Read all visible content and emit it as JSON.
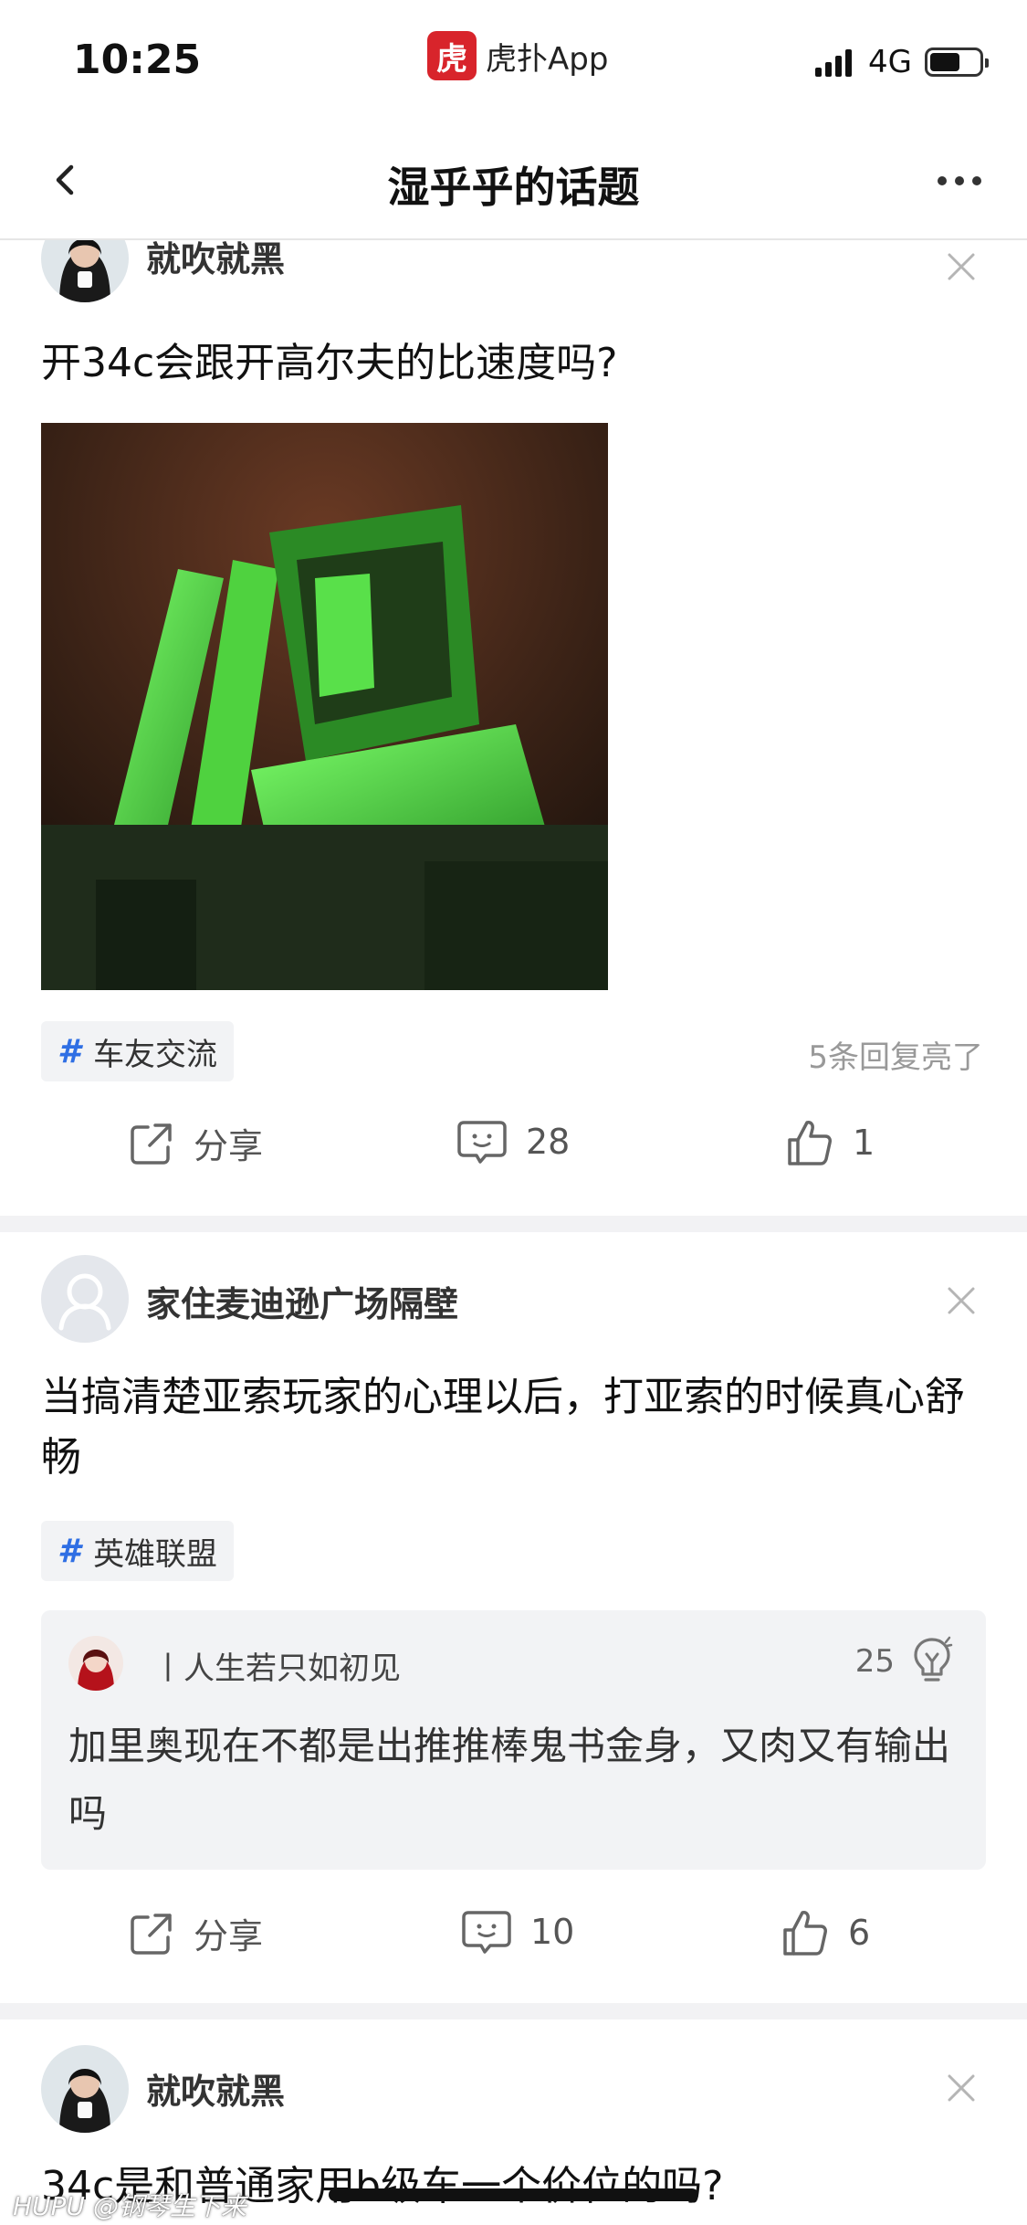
{
  "status_bar": {
    "time": "10:25",
    "app_logo_char": "虎",
    "app_name": "虎扑App",
    "network": "4G",
    "battery_level": 0.62
  },
  "nav": {
    "title": "湿乎乎的话题"
  },
  "posts": [
    {
      "author": "就吹就黑",
      "text": "开34c会跟开高尔夫的比速度吗?",
      "tag": "车友交流",
      "reply_note": "5条回复亮了",
      "share_label": "分享",
      "comments": "28",
      "likes": "1"
    },
    {
      "author": "家住麦迪逊广场隔壁",
      "text": "当搞清楚亚索玩家的心理以后，打亚索的时候真心舒畅",
      "tag": "英雄联盟",
      "hot_comment": {
        "author": "丨人生若只如初见",
        "likes": "25",
        "text": "加里奥现在不都是出推推棒鬼书金身，又肉又有输出吗"
      },
      "share_label": "分享",
      "comments": "10",
      "likes": "6"
    },
    {
      "author": "就吹就黑",
      "text": "34c是和普通家用b级车一个价位的吗?"
    }
  ],
  "watermark": "HUPU @钢琴生下来",
  "colors": {
    "brand_red": "#d8242b",
    "tag_blue": "#2f6fe4",
    "divider": "#f2f2f4"
  }
}
